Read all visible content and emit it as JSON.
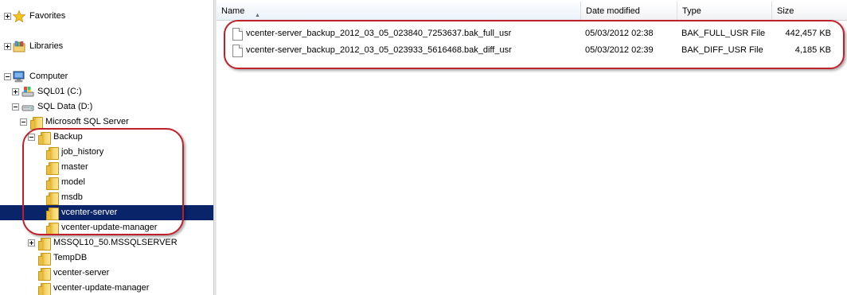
{
  "nav": {
    "favorites": "Favorites",
    "libraries": "Libraries",
    "computer": "Computer",
    "drive_c": "SQL01 (C:)",
    "drive_d": "SQL Data (D:)",
    "mssql": "Microsoft SQL Server",
    "backup": "Backup",
    "job_history": "job_history",
    "master": "master",
    "model": "model",
    "msdb": "msdb",
    "vcenter_server": "vcenter-server",
    "vcenter_update_manager": "vcenter-update-manager",
    "mssql10": "MSSQL10_50.MSSQLSERVER",
    "tempdb": "TempDB",
    "vcenter_server_2": "vcenter-server",
    "vcenter_update_manager_2": "vcenter-update-manager"
  },
  "columns": {
    "name": "Name",
    "date": "Date modified",
    "type": "Type",
    "size": "Size",
    "sort_arrow": "▲"
  },
  "files": [
    {
      "name": "vcenter-server_backup_2012_03_05_023840_7253637.bak_full_usr",
      "date": "05/03/2012 02:38",
      "type": "BAK_FULL_USR File",
      "size": "442,457 KB"
    },
    {
      "name": "vcenter-server_backup_2012_03_05_023933_5616468.bak_diff_usr",
      "date": "05/03/2012 02:39",
      "type": "BAK_DIFF_USR File",
      "size": "4,185 KB"
    }
  ],
  "colors": {
    "selection": "#0a246a",
    "annotation": "#c0202a"
  }
}
